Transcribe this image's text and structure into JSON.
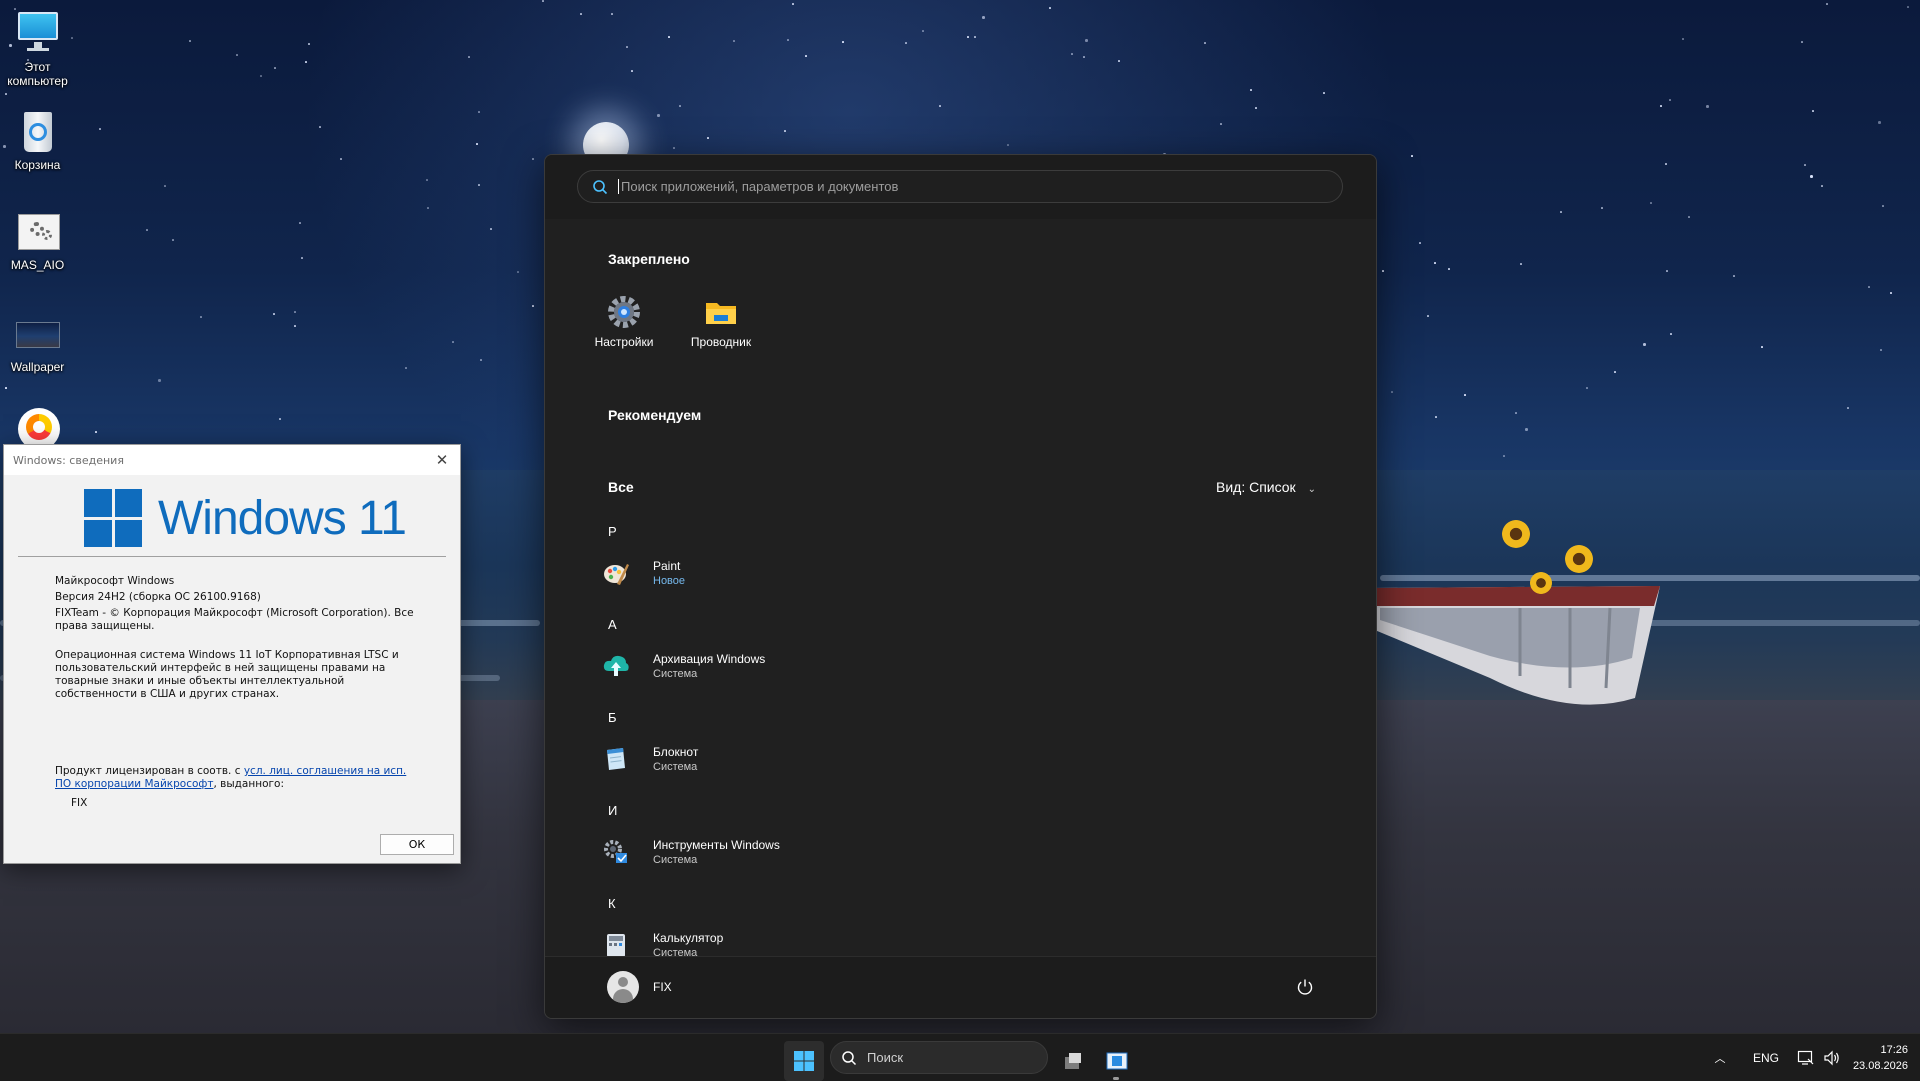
{
  "desktop": {
    "icons": [
      {
        "label": "Этот компьютер",
        "icon": "this-pc-icon"
      },
      {
        "label": "Корзина",
        "icon": "recycle-bin-icon"
      },
      {
        "label": "MAS_AIO",
        "icon": "script-gear-icon"
      },
      {
        "label": "Wallpaper",
        "icon": "image-file-icon"
      },
      {
        "label": "",
        "icon": "yandex-browser-icon"
      }
    ]
  },
  "winver": {
    "title": "Windows: сведения",
    "logo_text": "Windows 11",
    "product": "Майкрософт Windows",
    "version": "Версия 24H2 (сборка ОС 26100.9168)",
    "copyright": "FIXTeam - © Корпорация Майкрософт (Microsoft Corporation). Все права защищены.",
    "description": "Операционная система Windows 11 IoT Корпоративная LTSC и пользовательский интерфейс в ней защищены правами на товарные знаки и иные объекты интеллектуальной собственности в США и других странах.",
    "license_prefix": "Продукт лицензирован в соотв. с",
    "license_link": "усл. лиц. соглашения на исп. ПО корпорации Майкрософт",
    "license_suffix": ", выданного:",
    "licensee": "FIX",
    "ok_label": "ОК"
  },
  "start_menu": {
    "search_placeholder": "Поиск приложений, параметров и документов",
    "pinned_title": "Закреплено",
    "pinned": [
      {
        "label": "Настройки",
        "icon": "settings-gear-icon"
      },
      {
        "label": "Проводник",
        "icon": "file-explorer-folder-icon"
      }
    ],
    "recommended_title": "Рекомендуем",
    "all_title": "Все",
    "view_label": "Вид: Список",
    "groups": [
      {
        "letter": "P",
        "apps": [
          {
            "name": "Paint",
            "sub": "Новое",
            "icon": "paint-palette-icon"
          }
        ]
      },
      {
        "letter": "А",
        "apps": [
          {
            "name": "Архивация Windows",
            "sub": "Система",
            "icon": "backup-cloud-icon"
          }
        ]
      },
      {
        "letter": "Б",
        "apps": [
          {
            "name": "Блокнот",
            "sub": "Система",
            "icon": "notepad-icon"
          }
        ]
      },
      {
        "letter": "И",
        "apps": [
          {
            "name": "Инструменты Windows",
            "sub": "Система",
            "icon": "windows-tools-icon"
          }
        ]
      },
      {
        "letter": "К",
        "apps": [
          {
            "name": "Калькулятор",
            "sub": "Система",
            "icon": "calculator-icon"
          }
        ]
      }
    ],
    "user_name": "FIX"
  },
  "taskbar": {
    "search_label": "Поиск",
    "language": "ENG",
    "time": "17:26",
    "date": "23.08.2026"
  },
  "colors": {
    "accent": "#0f6cbd",
    "start_bg": "#202020",
    "taskbar_bg": "#1c1c1c",
    "link": "#0645ad"
  }
}
